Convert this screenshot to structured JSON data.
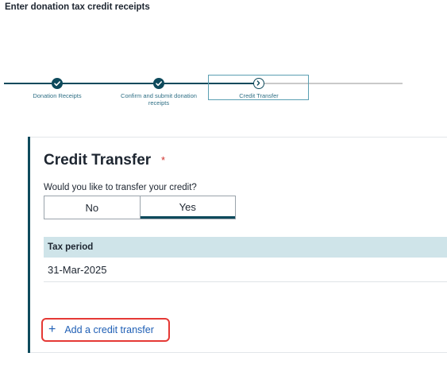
{
  "page": {
    "heading": "Enter donation tax credit receipts"
  },
  "stepper": {
    "steps": [
      {
        "label": "Donation Receipts",
        "status": "complete"
      },
      {
        "label": "Confirm and submit donation receipts",
        "status": "complete"
      },
      {
        "label": "Credit Transfer",
        "status": "current"
      }
    ]
  },
  "section": {
    "title": "Credit Transfer",
    "required_marker": "*",
    "question": "Would you like to transfer your credit?",
    "options": {
      "no": "No",
      "yes": "Yes"
    },
    "selected_option": "Yes"
  },
  "table": {
    "header": "Tax period",
    "rows": [
      "31-Mar-2025"
    ]
  },
  "add_link": {
    "icon": "+",
    "label": "Add a credit transfer"
  },
  "colors": {
    "primary": "#0e4a5c",
    "link": "#1f5fb5",
    "required": "#d0312d",
    "table_header": "#cfe4e9",
    "highlight": "#e53935"
  }
}
